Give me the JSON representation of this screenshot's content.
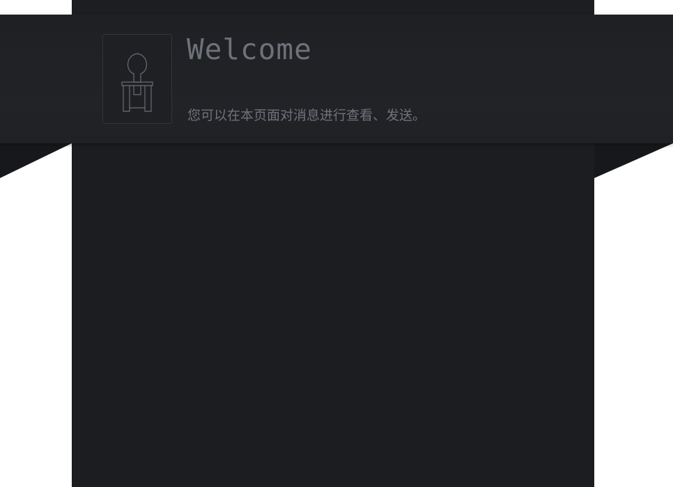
{
  "header": {
    "title": "Welcome",
    "subtitle": "您可以在本页面对消息进行查看、发送。"
  },
  "avatar": {
    "icon": "user-silhouette-icon"
  },
  "colors": {
    "panel_bg": "#1c1d20",
    "banner_bg": "#222327",
    "text_muted": "#6e717a",
    "page_bg": "#ffffff"
  }
}
